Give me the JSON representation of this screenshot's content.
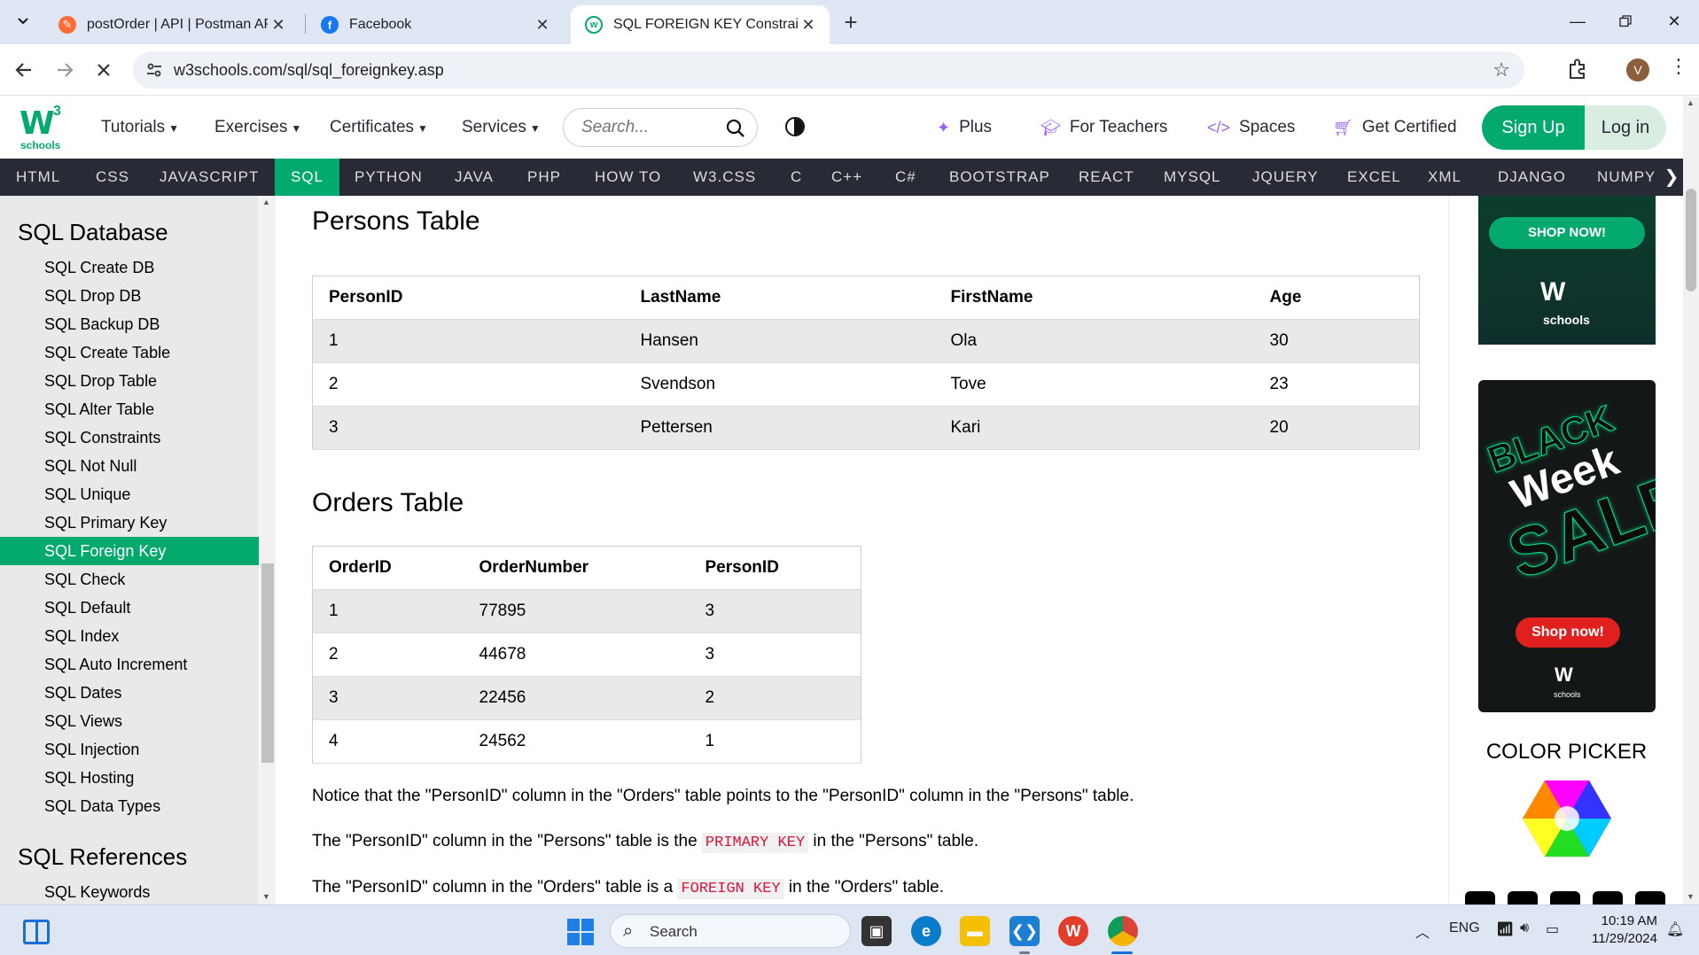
{
  "browser": {
    "tabs": [
      {
        "title": "postOrder | API | Postman API N",
        "icon": "postman-icon"
      },
      {
        "title": "Facebook",
        "icon": "facebook-icon"
      },
      {
        "title": "SQL FOREIGN KEY Constraint",
        "icon": "w3schools-icon"
      }
    ],
    "url": "w3schools.com/sql/sql_foreignkey.asp",
    "profile_initial": "V"
  },
  "topnav": {
    "logo_text": "W",
    "logo_sup": "3",
    "logo_sub": "schools",
    "menu": [
      "Tutorials",
      "Exercises",
      "Certificates",
      "Services"
    ],
    "search_placeholder": "Search...",
    "links": [
      "Plus",
      "For Teachers",
      "Spaces",
      "Get Certified"
    ],
    "signup": "Sign Up",
    "login": "Log in"
  },
  "subnav": [
    "HTML",
    "CSS",
    "JAVASCRIPT",
    "SQL",
    "PYTHON",
    "JAVA",
    "PHP",
    "HOW TO",
    "W3.CSS",
    "C",
    "C++",
    "C#",
    "BOOTSTRAP",
    "REACT",
    "MYSQL",
    "JQUERY",
    "EXCEL",
    "XML",
    "DJANGO",
    "NUMPY"
  ],
  "sidebar": {
    "heading1": "SQL Database",
    "items": [
      "SQL Create DB",
      "SQL Drop DB",
      "SQL Backup DB",
      "SQL Create Table",
      "SQL Drop Table",
      "SQL Alter Table",
      "SQL Constraints",
      "SQL Not Null",
      "SQL Unique",
      "SQL Primary Key",
      "SQL Foreign Key",
      "SQL Check",
      "SQL Default",
      "SQL Index",
      "SQL Auto Increment",
      "SQL Dates",
      "SQL Views",
      "SQL Injection",
      "SQL Hosting",
      "SQL Data Types"
    ],
    "active_item": "SQL Foreign Key",
    "heading2": "SQL References",
    "items2": [
      "SQL Keywords"
    ]
  },
  "main": {
    "persons_title": "Persons Table",
    "persons_headers": [
      "PersonID",
      "LastName",
      "FirstName",
      "Age"
    ],
    "persons_rows": [
      [
        "1",
        "Hansen",
        "Ola",
        "30"
      ],
      [
        "2",
        "Svendson",
        "Tove",
        "23"
      ],
      [
        "3",
        "Pettersen",
        "Kari",
        "20"
      ]
    ],
    "orders_title": "Orders Table",
    "orders_headers": [
      "OrderID",
      "OrderNumber",
      "PersonID"
    ],
    "orders_rows": [
      [
        "1",
        "77895",
        "3"
      ],
      [
        "2",
        "44678",
        "3"
      ],
      [
        "3",
        "22456",
        "2"
      ],
      [
        "4",
        "24562",
        "1"
      ]
    ],
    "notice": "Notice that the \"PersonID\" column in the \"Orders\" table points to the \"PersonID\" column in the \"Persons\" table.",
    "p2_before": "The \"PersonID\" column in the \"Persons\" table is the ",
    "p2_code": "PRIMARY KEY",
    "p2_after": " in the \"Persons\" table.",
    "p3_before": "The \"PersonID\" column in the \"Orders\" table is a ",
    "p3_code": "FOREIGN KEY",
    "p3_after": " in the \"Orders\" table."
  },
  "right": {
    "ad1_button": "SHOP NOW!",
    "ad1_logo": "W",
    "ad1_logo_sub": "schools",
    "ad2_line1": "BLACK",
    "ad2_line2": "Week",
    "ad2_line3": "SALE",
    "ad2_button": "Shop now!",
    "ad2_logo": "W",
    "ad2_logo_sub": "schools",
    "color_picker": "COLOR PICKER"
  },
  "taskbar": {
    "search": "Search",
    "lang": "ENG",
    "time": "10:19 AM",
    "date": "11/29/2024"
  },
  "colors": {
    "accent": "#04aa6d",
    "dark": "#282a35",
    "code_red": "#dc143c"
  }
}
